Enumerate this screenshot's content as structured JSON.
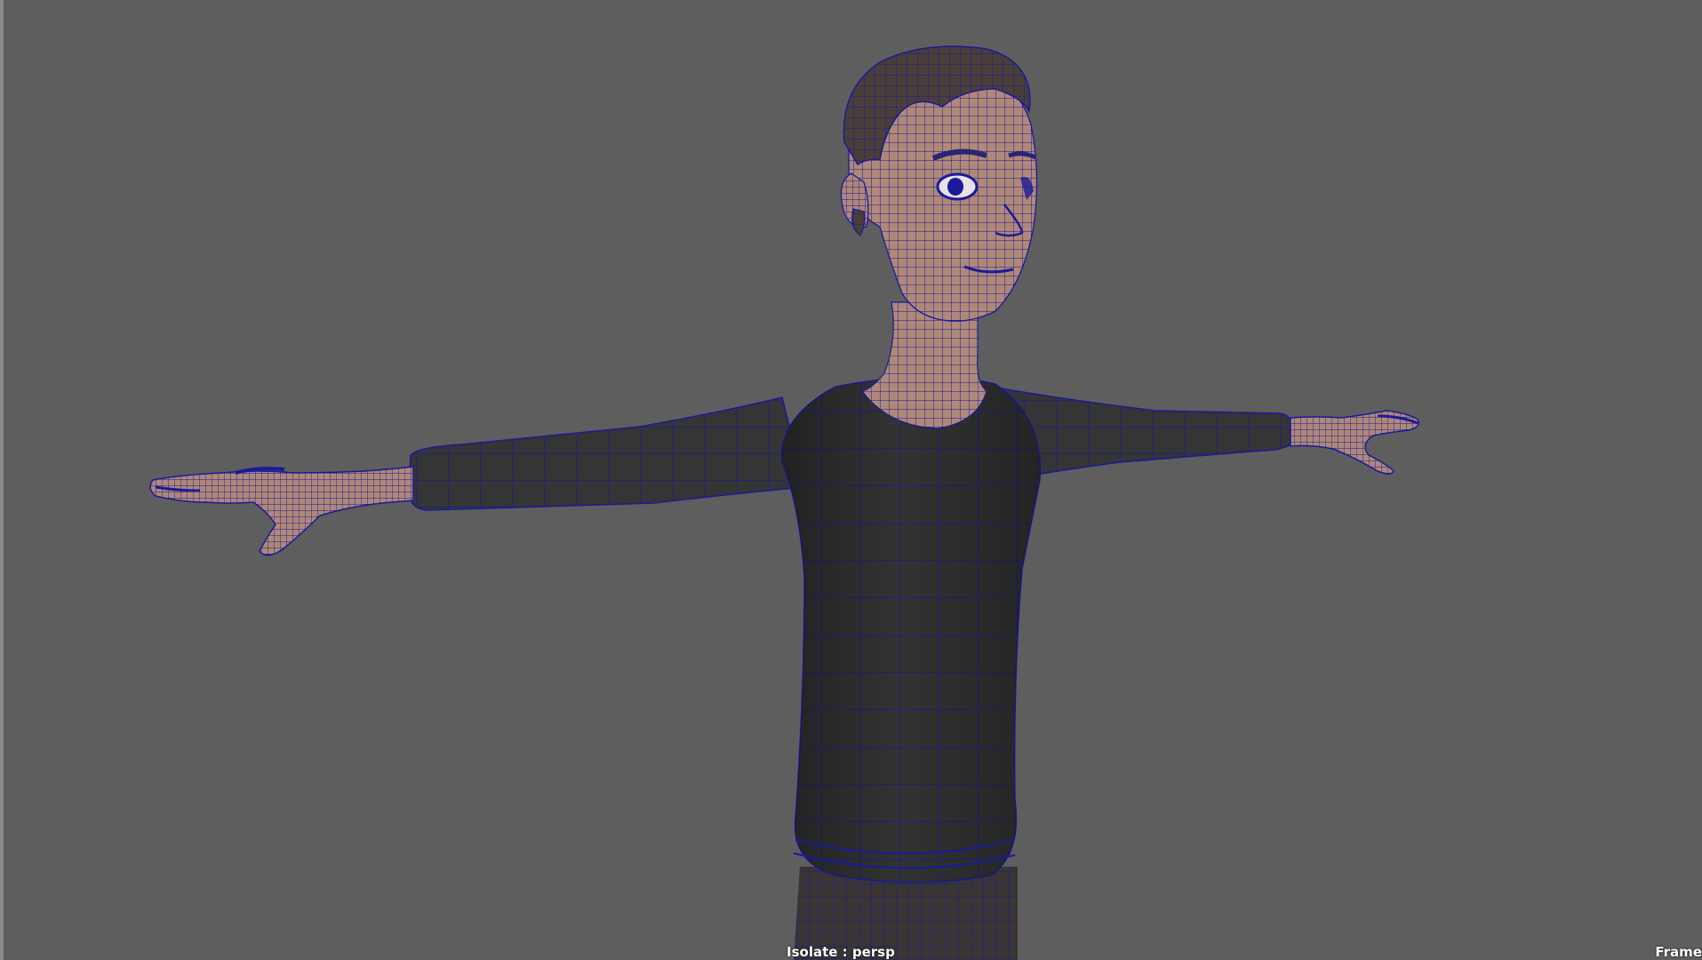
{
  "viewport": {
    "camera": "persp",
    "background_color": "#5e5e5e",
    "wireframe_color": "#1a1a9a",
    "skin_color": "#b08878",
    "shirt_color": "#333333",
    "pants_color": "#3a3533",
    "hair_color": "#4a3e38"
  },
  "hud": {
    "isolate_label": "Isolate : persp",
    "frame_label": "Frame"
  },
  "model": {
    "name": "character",
    "pose": "T-pose",
    "display": "wireframe-on-shaded"
  }
}
